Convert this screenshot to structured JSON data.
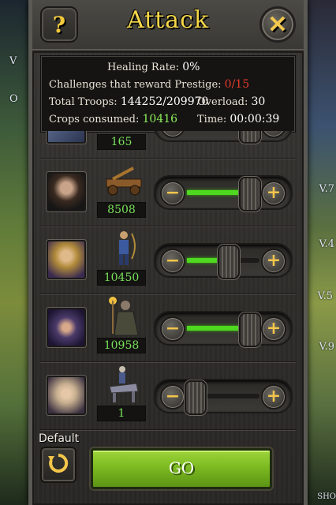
{
  "dialog": {
    "title": "Attack",
    "help_label": "?",
    "close_label": "✕"
  },
  "background": {
    "labels": [
      "V",
      "O",
      "V.7",
      "V.4",
      "V.5",
      "V.9",
      "SHO"
    ]
  },
  "info": {
    "healing_rate_label": "Healing Rate:",
    "healing_rate_value": "0%",
    "prestige_label": "Challenges that reward Prestige:",
    "prestige_value": "0/15",
    "total_troops_label": "Total Troops:",
    "total_troops_value": "144252/209970",
    "overload_label": "Overload:",
    "overload_value": "30",
    "crops_label": "Crops consumed:",
    "crops_value": "10416",
    "time_label": "Time:",
    "time_value": "00:00:39"
  },
  "troops": [
    {
      "count": "165",
      "unit_icon": "knight-icon",
      "slider_fraction": 0.85
    },
    {
      "count": "8508",
      "unit_icon": "catapult-icon",
      "slider_fraction": 0.85
    },
    {
      "count": "10450",
      "unit_icon": "archer-icon",
      "slider_fraction": 0.55
    },
    {
      "count": "10958",
      "unit_icon": "mage-icon",
      "slider_fraction": 0.85
    },
    {
      "count": "1",
      "unit_icon": "cavalry-icon",
      "slider_fraction": 0.1
    }
  ],
  "footer": {
    "default_label": "Default",
    "go_label": "GO"
  },
  "colors": {
    "title": "#f5d74a",
    "count_text": "#78e05a",
    "slider_fill": "#4fd820",
    "prestige_value": "#e23a2c",
    "crops_value": "#8ef05a",
    "go_button": "#7dba22"
  }
}
